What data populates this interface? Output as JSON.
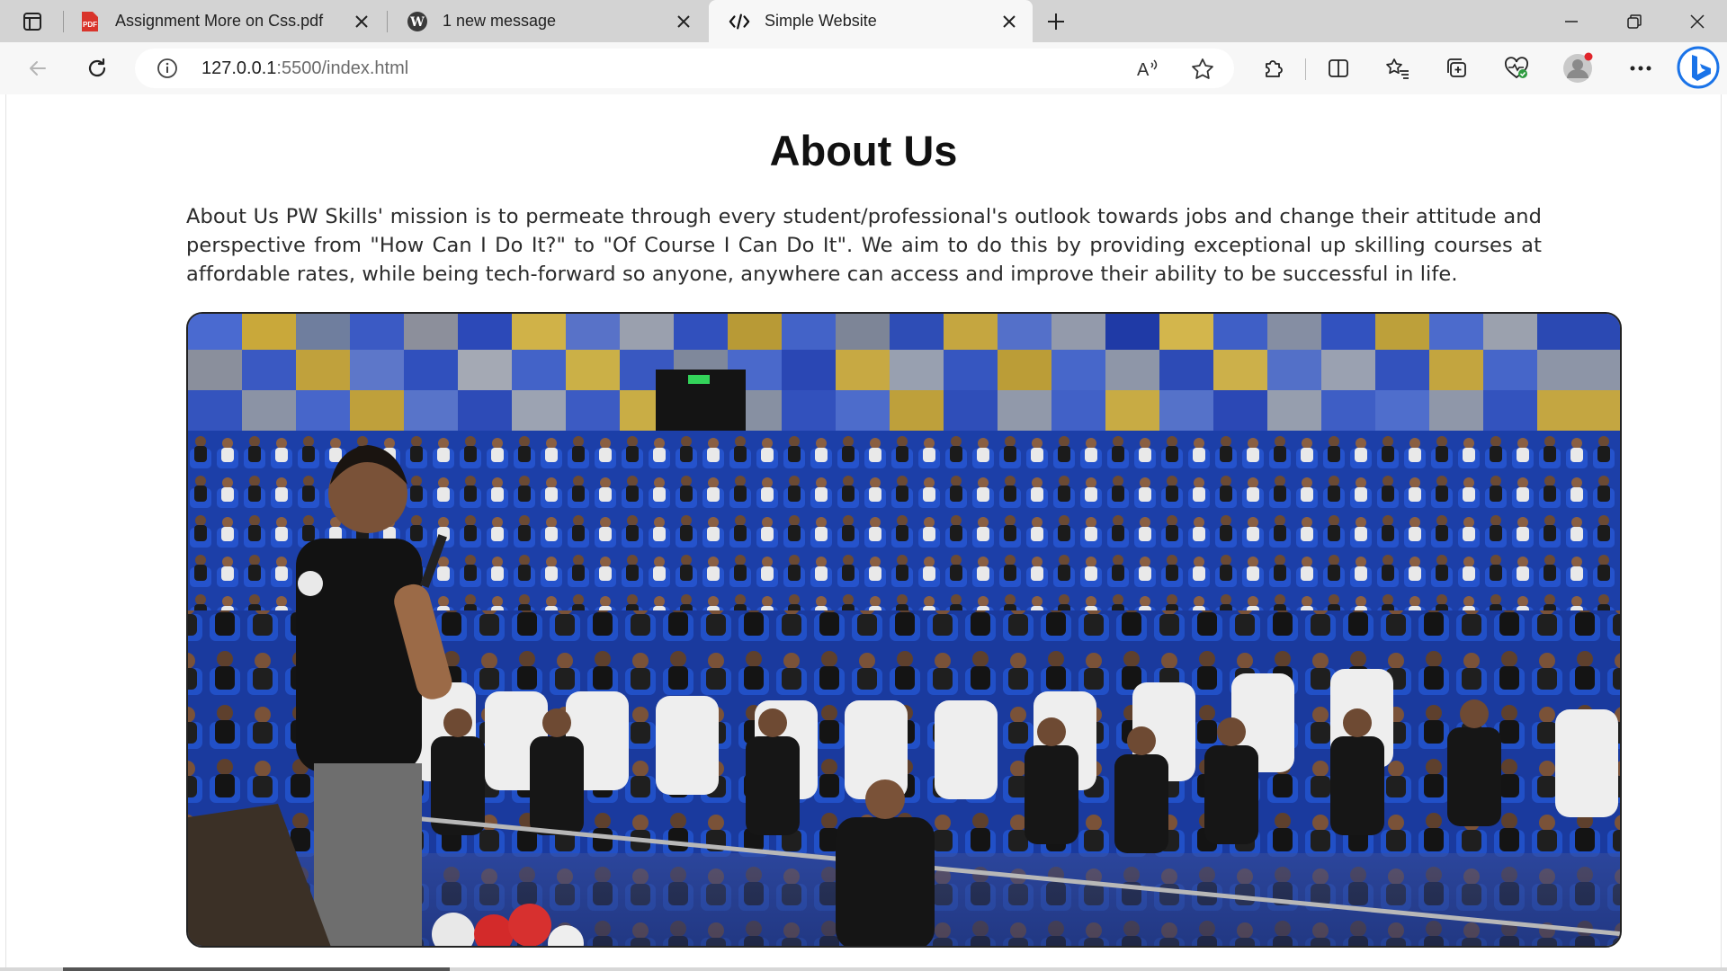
{
  "browser": {
    "tabs": [
      {
        "title": "Assignment More on Css.pdf",
        "icon": "pdf-icon"
      },
      {
        "title": "1 new message",
        "icon": "wordpress-icon"
      },
      {
        "title": "Simple Website",
        "icon": "code-icon",
        "active": true
      }
    ],
    "address": {
      "host": "127.0.0.1",
      "path": ":5500/index.html"
    }
  },
  "page": {
    "title": "About Us",
    "paragraph": "About Us PW Skills' mission is to permeate through every student/professional's outlook towards jobs and change their attitude and perspective from \"How Can I Do It?\" to \"Of Course I Can Do It\". We aim to do this by providing exceptional up skilling courses at affordable rates, while being tech-forward so anyone, anywhere can access and improve their ability to be successful in life."
  },
  "colors": {
    "tabstrip": "#d3d3d3",
    "toolbar": "#f7f7f7",
    "seat_blue": "#1f45b8",
    "wall_blue": "#3c6ad6",
    "bing_blue": "#1a73e8"
  }
}
